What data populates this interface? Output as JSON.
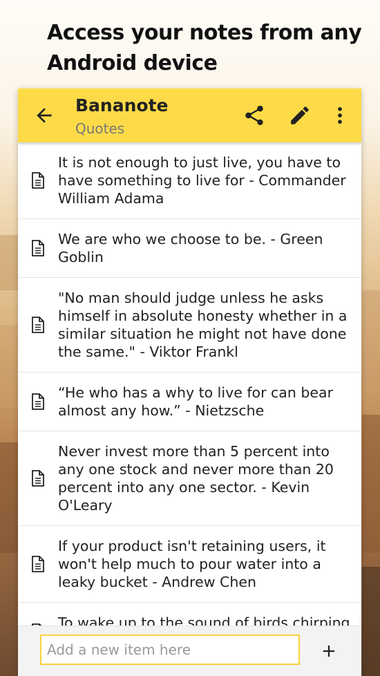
{
  "promo": {
    "headline": "Access your notes from any Android device"
  },
  "appbar": {
    "title": "Bananote",
    "subtitle": "Quotes",
    "back_icon": "arrow-back-icon",
    "share_icon": "share-icon",
    "edit_icon": "pencil-icon",
    "more_icon": "more-vert-icon",
    "color": "#fddb48"
  },
  "notes": [
    {
      "text": "It is not enough to just live, you have to have something to live for - Commander William Adama",
      "icon": "document-icon"
    },
    {
      "text": "We are who we choose to be. - Green Goblin",
      "icon": "document-icon"
    },
    {
      "text": "\"No man should judge unless he asks himself in absolute honesty whether in a similar situation he might not have done the same.\" - Viktor Frankl",
      "icon": "document-icon"
    },
    {
      "text": "“He who has a why to live for can bear almost any how.” - Nietzsche",
      "icon": "document-icon"
    },
    {
      "text": "Never invest more than 5 percent into any one stock and never more than 20 percent into any one sector. - Kevin O'Leary",
      "icon": "document-icon"
    },
    {
      "text": "If your product isn't retaining users, it won't help much to pour water into a leaky bucket - Andrew Chen",
      "icon": "document-icon"
    },
    {
      "text": "To wake up to the sound of birds chirping is a gift because for as long as you are",
      "icon": "document-icon"
    }
  ],
  "composer": {
    "placeholder": "Add a new item here",
    "value": "",
    "add_icon": "plus-icon",
    "accent": "#f5d23c"
  }
}
